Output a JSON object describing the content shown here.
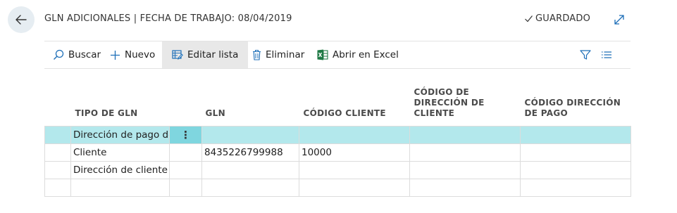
{
  "header": {
    "title": "GLN ADICIONALES | FECHA DE TRABAJO: 08/04/2019",
    "status": "GUARDADO"
  },
  "toolbar": {
    "search_label": "Buscar",
    "new_label": "Nuevo",
    "edit_list_label": "Editar lista",
    "delete_label": "Eliminar",
    "excel_label": "Abrir en Excel"
  },
  "table": {
    "columns": {
      "tipo": "TIPO DE GLN",
      "gln": "GLN",
      "codigo_cliente": "CÓDIGO CLIENTE",
      "codigo_direccion_cliente": [
        "CÓDIGO DE",
        "DIRECCIÓN DE",
        "CLIENTE"
      ],
      "codigo_direccion_pago": [
        "CÓDIGO DIRECCIÓN",
        "DE PAGO"
      ]
    },
    "rows": [
      {
        "tipo": "Dirección de pago del",
        "gln": "",
        "codigo_cliente": "",
        "codigo_direccion_cliente": "",
        "codigo_direccion_pago": ""
      },
      {
        "tipo": "Cliente",
        "gln": "8435226799988",
        "codigo_cliente": "10000",
        "codigo_direccion_cliente": "",
        "codigo_direccion_pago": ""
      },
      {
        "tipo": "Dirección de cliente",
        "gln": "",
        "codigo_cliente": "",
        "codigo_direccion_cliente": "",
        "codigo_direccion_pago": ""
      },
      {
        "tipo": "",
        "gln": "",
        "codigo_cliente": "",
        "codigo_direccion_cliente": "",
        "codigo_direccion_pago": ""
      }
    ]
  },
  "colors": {
    "selected_row": "#b3e8ec",
    "selected_actions": "#7fd6df",
    "back_button": "#e6edf2",
    "icon_blue": "#1e6fb8",
    "excel_green": "#1f7a45"
  }
}
